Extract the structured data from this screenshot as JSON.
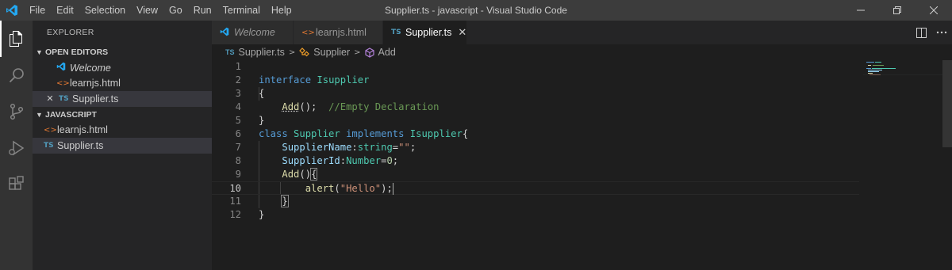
{
  "titlebar": {
    "menus": [
      "File",
      "Edit",
      "Selection",
      "View",
      "Go",
      "Run",
      "Terminal",
      "Help"
    ],
    "title": "Supplier.ts - javascript - Visual Studio Code"
  },
  "sidebar": {
    "title": "EXPLORER",
    "open_editors": {
      "label": "OPEN EDITORS",
      "items": [
        {
          "name": "Welcome",
          "icon": "vscode-icon"
        },
        {
          "name": "learnjs.html",
          "icon": "html-icon"
        },
        {
          "name": "Supplier.ts",
          "icon": "ts-icon",
          "close": "✕",
          "ts": "TS"
        }
      ]
    },
    "folder": {
      "label": "JAVASCRIPT",
      "items": [
        {
          "name": "learnjs.html",
          "icon": "html-icon"
        },
        {
          "name": "Supplier.ts",
          "icon": "ts-icon",
          "ts": "TS"
        }
      ]
    }
  },
  "tabs": [
    {
      "label": "Welcome",
      "icon": "vscode-icon"
    },
    {
      "label": "learnjs.html",
      "icon": "html-icon"
    },
    {
      "label": "Supplier.ts",
      "icon": "ts-icon",
      "ts": "TS",
      "close": "✕",
      "active": true
    }
  ],
  "breadcrumb": {
    "file": "Supplier.ts",
    "file_icon": "TS",
    "class": "Supplier",
    "method": "Add"
  },
  "editor": {
    "line_numbers": [
      "1",
      "2",
      "3",
      "4",
      "5",
      "6",
      "7",
      "8",
      "9",
      "10",
      "11",
      "12"
    ],
    "code": {
      "l2_kw": "interface",
      "l2_name": "Isupplier",
      "l3": "{",
      "l4_fn": "Add",
      "l4_rest": "();",
      "l4_comment": "//Empty Declaration",
      "l5": "}",
      "l6_kw": "class",
      "l6_name": "Supplier",
      "l6_kw2": "implements",
      "l6_iface": "Isupplier",
      "l6_brace": "{",
      "l7_var": "SupplierName",
      "l7_colon": ":",
      "l7_type": "string",
      "l7_eq": "=",
      "l7_str": "\"\"",
      "l7_semi": ";",
      "l8_var": "SupplierId",
      "l8_colon": ":",
      "l8_type": "Number",
      "l8_eq": "=",
      "l8_num": "0",
      "l8_semi": ";",
      "l9_fn": "Add",
      "l9_paren": "()",
      "l9_brace": "{",
      "l10_fn": "alert",
      "l10_open": "(",
      "l10_str": "\"Hello\"",
      "l10_close": ");",
      "l11": "}",
      "l12": "}"
    },
    "current_line": "10"
  }
}
